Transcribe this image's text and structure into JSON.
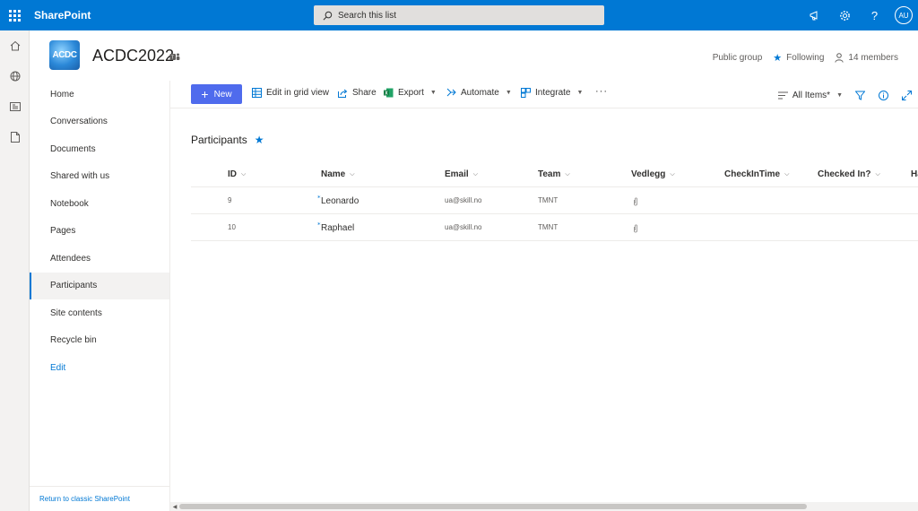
{
  "suitebar": {
    "brand": "SharePoint",
    "search_placeholder": "Search this list",
    "avatar_initials": "AU"
  },
  "site": {
    "logo_text": "ACDC",
    "title": "ACDC2022",
    "privacy": "Public group",
    "following": "Following",
    "members": "14 members"
  },
  "nav": {
    "items": [
      {
        "label": "Home"
      },
      {
        "label": "Conversations"
      },
      {
        "label": "Documents"
      },
      {
        "label": "Shared with us"
      },
      {
        "label": "Notebook"
      },
      {
        "label": "Pages"
      },
      {
        "label": "Attendees"
      },
      {
        "label": "Participants"
      },
      {
        "label": "Site contents"
      },
      {
        "label": "Recycle bin"
      }
    ],
    "edit": "Edit",
    "footer": "Return to classic SharePoint"
  },
  "commandbar": {
    "new": "New",
    "grid_view": "Edit in grid view",
    "share": "Share",
    "export": "Export",
    "automate": "Automate",
    "integrate": "Integrate",
    "more": "···",
    "view": "All Items*"
  },
  "list": {
    "title": "Participants",
    "columns": [
      "ID",
      "Name",
      "Email",
      "Team",
      "Vedlegg",
      "CheckInTime",
      "Checked In?",
      "Ha"
    ],
    "rows": [
      {
        "id": "9",
        "name": "Leonardo",
        "email": "ua@skill.no",
        "team": "TMNT"
      },
      {
        "id": "10",
        "name": "Raphael",
        "email": "ua@skill.no",
        "team": "TMNT"
      }
    ]
  },
  "colors": {
    "accent": "#0078d4",
    "new_button": "#4f6bed"
  }
}
